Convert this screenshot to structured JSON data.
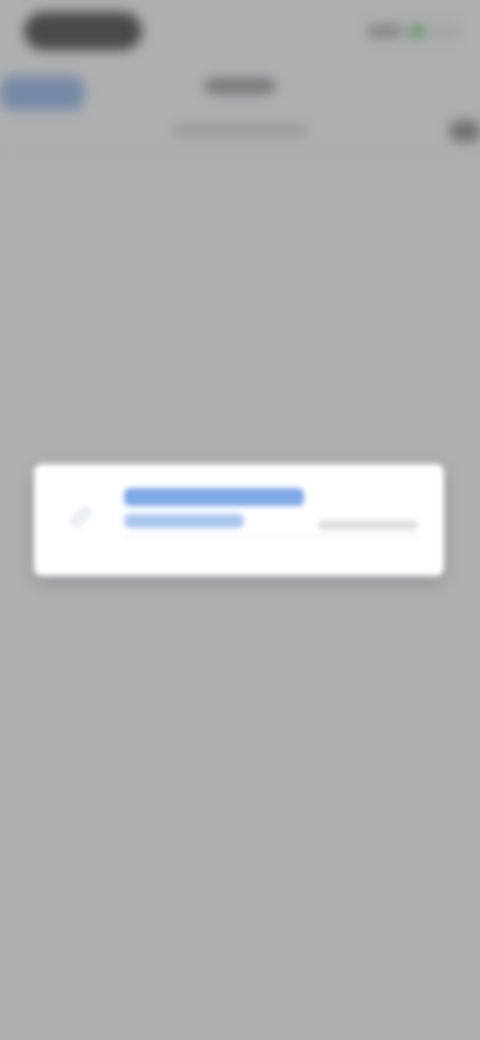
{
  "screen": {
    "scrim_color": "#78787a",
    "accent": "#2d6fd0"
  },
  "status_bar": {
    "icons": [
      "signal-icon",
      "wifi-icon",
      "battery-icon"
    ]
  },
  "nav": {
    "back_icon": "chevron-left-icon"
  },
  "popup": {
    "icon": "link-icon",
    "title": "",
    "link": "",
    "meta": ""
  }
}
